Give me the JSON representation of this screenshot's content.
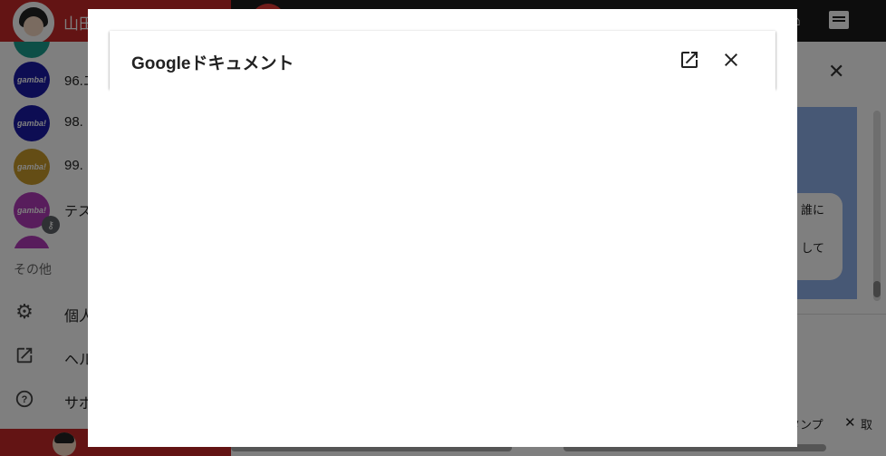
{
  "user": {
    "name": "山田"
  },
  "rooms": [
    {
      "label": "",
      "avatar_text": "",
      "color": "#1a9e8f"
    },
    {
      "label": "96.エ",
      "avatar_text": "gamba!",
      "color": "#1a1aa6"
    },
    {
      "label": "98. ",
      "avatar_text": "gamba!",
      "color": "#1a1aa6"
    },
    {
      "label": "99. ",
      "avatar_text": "gamba!",
      "color": "#c89a2a"
    },
    {
      "label": "テス",
      "avatar_text": "gamba!",
      "color": "#b03ab8"
    },
    {
      "label": "",
      "avatar_text": "",
      "color": "#b03ab8"
    }
  ],
  "sidebar": {
    "section_label": "その他",
    "menu": [
      {
        "label": "個人",
        "icon": "gear-icon"
      },
      {
        "label": "ヘル",
        "icon": "open-in-new-icon"
      },
      {
        "label": "サポ",
        "icon": "help-icon"
      }
    ]
  },
  "panel": {
    "bubble_lines": [
      "誰に",
      "して"
    ],
    "stamp_label": "タンプ",
    "take_label": "取"
  },
  "dialog": {
    "title": "Googleドキュメント"
  },
  "colors": {
    "sidebar_red": "#c62828",
    "appbar": "#1a1a1a",
    "chat_blue": "#8fb0ea"
  }
}
